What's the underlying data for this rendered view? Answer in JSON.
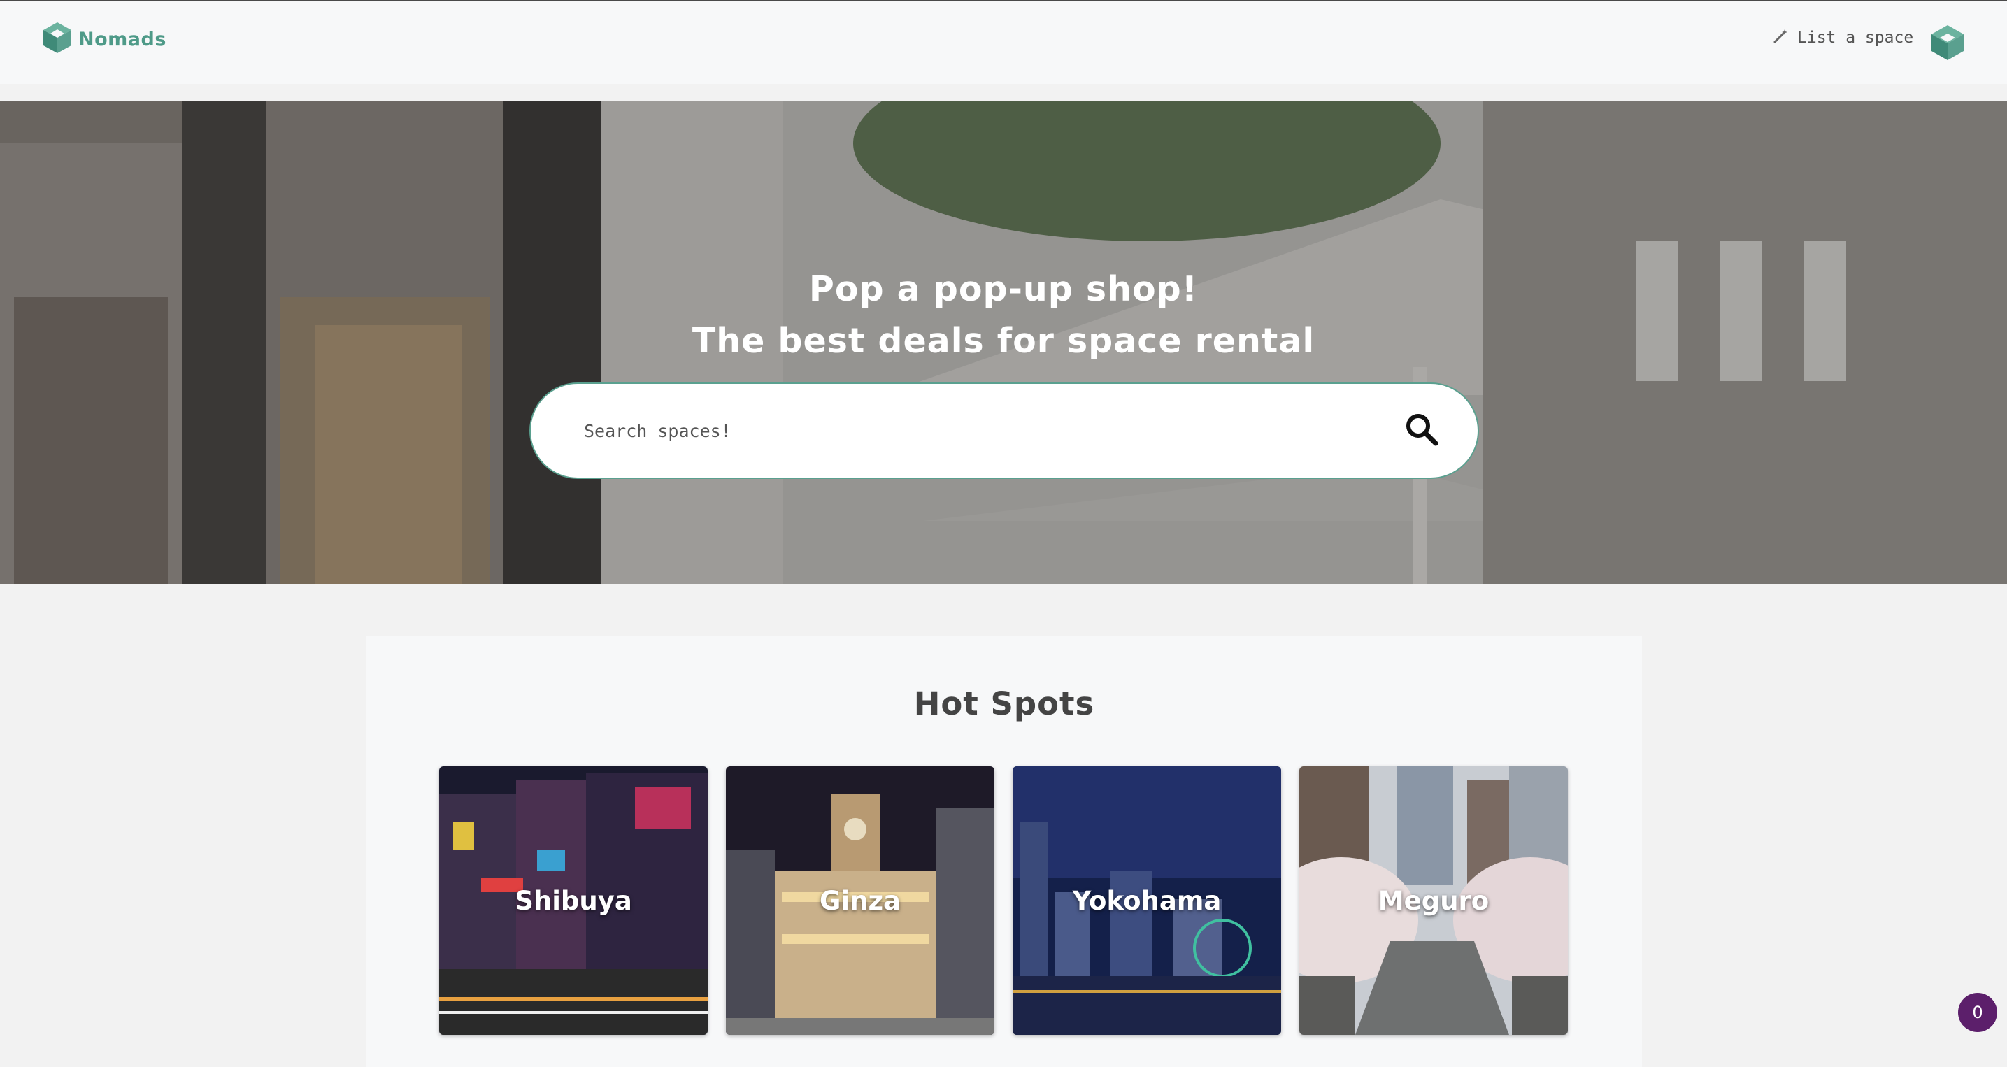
{
  "navbar": {
    "brand": "Nomads",
    "list_space_label": "List a space"
  },
  "hero": {
    "title_line1": "Pop a pop-up shop!",
    "title_line2": "The best deals for space rental",
    "search_placeholder": "Search spaces!"
  },
  "hot_spots": {
    "title": "Hot Spots",
    "cards": [
      {
        "label": "Shibuya"
      },
      {
        "label": "Ginza"
      },
      {
        "label": "Yokohama"
      },
      {
        "label": "Meguro"
      }
    ]
  },
  "badge": {
    "count": "0"
  },
  "colors": {
    "brand": "#4e9a88",
    "search_border": "#5aa08f",
    "badge": "#5c1f6b"
  },
  "icons": {
    "logo": "nomads-logo-icon",
    "list_space": "magic-wand-icon",
    "search": "search-icon",
    "account": "nomads-account-icon"
  }
}
